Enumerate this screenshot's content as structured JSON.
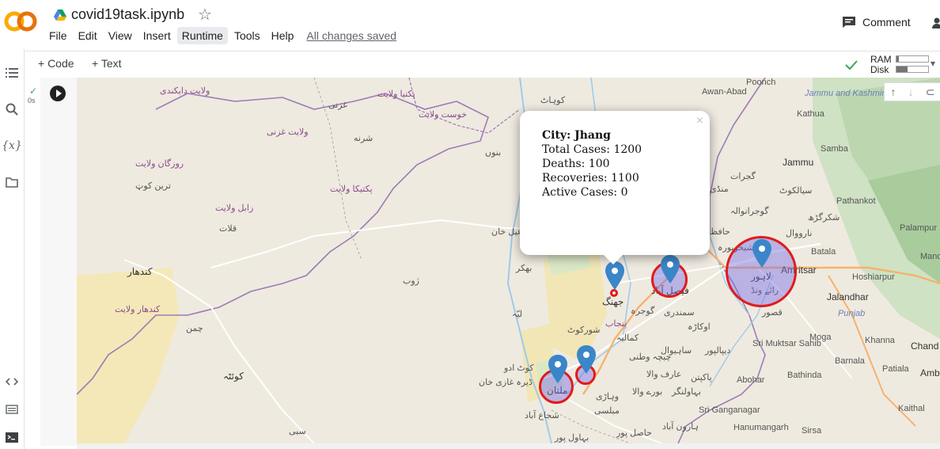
{
  "app": {
    "logo": "CO",
    "title": "covid19task.ipynb",
    "menu": [
      "File",
      "Edit",
      "View",
      "Insert",
      "Runtime",
      "Tools",
      "Help"
    ],
    "active_menu": "Runtime",
    "saved_status": "All changes saved",
    "comment_label": "Comment"
  },
  "toolbar": {
    "code_label": "+ Code",
    "text_label": "+ Text",
    "ram_label": "RAM",
    "disk_label": "Disk",
    "ram_fraction": 0.08,
    "disk_fraction": 0.35
  },
  "cell": {
    "status_check": "✓",
    "exec_time": "0s"
  },
  "popup": {
    "city": "City: Jhang",
    "total": "Total Cases: 1200",
    "deaths": "Deaths: 100",
    "recoveries": "Recoveries: 1100",
    "active": "Active Cases: 0",
    "close": "×"
  },
  "map_labels": {
    "l1": "ولایت دایکندی",
    "l2": "غزنی",
    "l3": "پکتیا ولایت",
    "l4": "خوست ولایت",
    "l5": "ولایت غزنی",
    "l6": "شرنه",
    "l7": "روزگان ولایت",
    "l8": "ترین کوټ",
    "l9": "زابل ولایت",
    "l10": "قلات",
    "l11": "پکتیکا ولایت",
    "l12": "کندهار",
    "l13": "کندهار ولایت",
    "l14": "چمن",
    "l15": "کوئٹہ",
    "l16": "ژوب",
    "l17": "بنوں",
    "l18": "کوہاٹ",
    "l19": "اسماعیل خان",
    "l20": "بھکر",
    "l21": "لیّہ",
    "l22": "شورکوٹ",
    "l23": "جھنگ",
    "l24": "فیصل آباد",
    "l25": "گوجرہ",
    "l26": "سمندری",
    "l27": "اوکاڑہ",
    "l28": "لاہور",
    "l29": "رائے ونڈ",
    "l30": "Amritsar",
    "l31": "Jalandhar",
    "l32": "Punjab",
    "l33": "Moga",
    "l34": "Khanna",
    "l35": "Chand",
    "l36": "ملتان",
    "l37": "کوٹ ادو",
    "l38": "ڈیرہ غازی خان",
    "l39": "شجاع آباد",
    "l40": "سبی",
    "l41": "ساہیوال",
    "l42": "پاکپتن",
    "l43": "بہاولنگر",
    "l44": "Sri Ganganagar",
    "l45": "Hanumangarh",
    "l46": "Sirsa",
    "l47": "Bathinda",
    "l48": "Abohar",
    "l49": "Sri Muktsar Sahib",
    "l50": "Barnala",
    "l51": "Patiala",
    "l52": "Kaithal",
    "l53": "Amb",
    "l54": "Batala",
    "l55": "Hoshiarpur",
    "l56": "Pathankot",
    "l57": "Palampur",
    "l58": "Mand",
    "l59": "Jammu",
    "l60": "Jammu and Kashmir",
    "l61": "سیالکوٹ",
    "l62": "گوجرانوالہ",
    "l63": "شیخوپورہ",
    "l64": "حافظ",
    "l65": "Awan-Abad",
    "l66": "Poonch",
    "l67": "منڈی",
    "l68": "گجرات",
    "l69": "قصور",
    "l70": "دیپالپور",
    "l71": "میلسی",
    "l72": "وہاڑی",
    "l73": "بورے والا",
    "l74": "حاصل پور",
    "l75": "بہاول پور",
    "l76": "ہارون آباد",
    "l77": "عارف والا",
    "l78": "چیچہ وطنی",
    "l79": "کمالیہ",
    "l80": "پنجاب",
    "l81": "Kathua",
    "l82": "نارووال",
    "l83": "شکرگڑھ",
    "l84": "Samba"
  }
}
